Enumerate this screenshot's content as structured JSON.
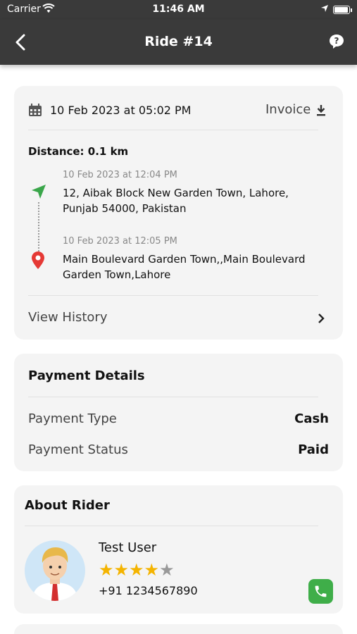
{
  "status_bar": {
    "carrier": "Carrier",
    "time": "11:46 AM"
  },
  "nav": {
    "title": "Ride #14"
  },
  "ride": {
    "datetime": "10 Feb 2023 at 05:02 PM",
    "invoice_label": "Invoice",
    "distance": "Distance: 0.1 km",
    "pickup": {
      "time": "10 Feb 2023 at 12:04 PM",
      "address_line1": "12, Aibak Block New Garden Town, Lahore,",
      "address_line2": "Punjab 54000, Pakistan"
    },
    "dropoff": {
      "time": "10 Feb 2023 at 12:05 PM",
      "address_line1": "Main Boulevard Garden Town,,Main Boulevard",
      "address_line2": "Garden Town,Lahore"
    },
    "view_history_label": "View History"
  },
  "payment": {
    "title": "Payment Details",
    "type_label": "Payment Type",
    "type_value": "Cash",
    "status_label": "Payment Status",
    "status_value": "Paid"
  },
  "rider": {
    "title": "About Rider",
    "name": "Test User",
    "rating": 4,
    "rating_max": 5,
    "phone": "+91 1234567890"
  },
  "colors": {
    "header": "#3a3a3a",
    "card": "#f4f4f4",
    "pickup_green": "#3aa64a",
    "dropoff_red": "#e53935",
    "star": "#f4b400",
    "call_green": "#3fae49"
  },
  "icons": [
    "wifi-icon",
    "location-arrow-icon",
    "battery-icon",
    "back-arrow-icon",
    "help-icon",
    "calendar-icon",
    "download-icon",
    "navigation-icon",
    "map-pin-icon",
    "chevron-right-icon",
    "star-icon",
    "avatar",
    "phone-icon"
  ]
}
